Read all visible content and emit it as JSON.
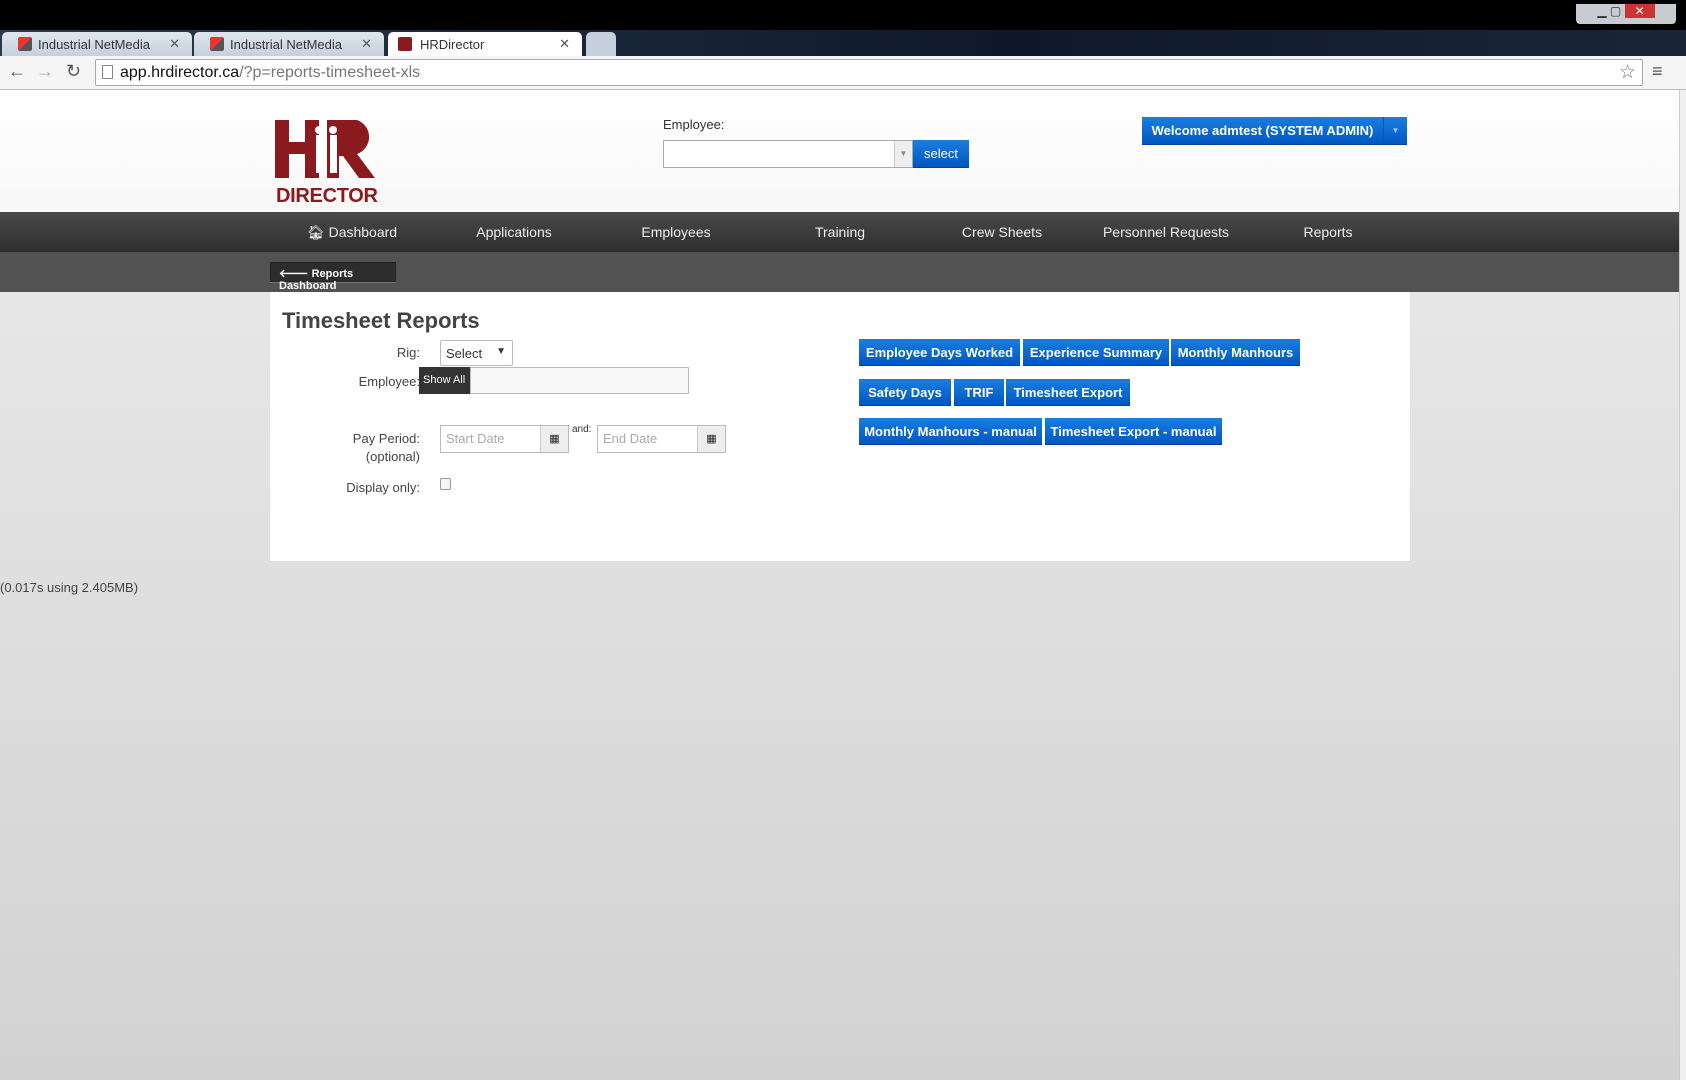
{
  "browser": {
    "tabs": [
      {
        "title": "Industrial NetMedia",
        "active": false
      },
      {
        "title": "Industrial NetMedia",
        "active": false
      },
      {
        "title": "HRDirector",
        "active": true
      }
    ],
    "url_host": "app.hrdirector.ca",
    "url_path": "/?p=reports-timesheet-xls",
    "icons": {
      "back": "arrow-left-icon",
      "forward": "arrow-right-icon",
      "reload": "reload-icon",
      "bookmark": "star-icon",
      "menu": "hamburger-icon"
    }
  },
  "header": {
    "logo_text": "HR DIRECTOR",
    "employee_label": "Employee:",
    "employee_value": "",
    "select_button": "select",
    "welcome_button": "Welcome admtest (SYSTEM ADMIN)",
    "brand_color": "#8b1a1f",
    "accent_color": "#0a6ad4"
  },
  "nav": {
    "items": [
      {
        "label": "Dashboard",
        "icon": "home-icon"
      },
      {
        "label": "Applications"
      },
      {
        "label": "Employees"
      },
      {
        "label": "Training"
      },
      {
        "label": "Crew Sheets"
      },
      {
        "label": "Personnel Requests"
      },
      {
        "label": "Reports"
      }
    ]
  },
  "subnav": {
    "back_button": "Reports Dashboard"
  },
  "main": {
    "title": "Timesheet Reports",
    "rig_label": "Rig:",
    "rig_value": "Select",
    "employee_label": "Employee:",
    "show_all": "Show All",
    "employee_value": "",
    "pay_period_label": "Pay Period:",
    "optional": "(optional)",
    "start_placeholder": "Start Date",
    "and_label": "and:",
    "end_placeholder": "End Date",
    "display_only_label": "Display only:",
    "display_only_checked": false,
    "report_buttons": [
      [
        "Employee Days Worked",
        "Experience Summary",
        "Monthly Manhours"
      ],
      [
        "Safety Days",
        "TRIF",
        "Timesheet Export"
      ],
      [
        "Monthly Manhours - manual",
        "Timesheet Export - manual"
      ]
    ]
  },
  "footer": {
    "timing": "(0.017s using 2.405MB)"
  }
}
